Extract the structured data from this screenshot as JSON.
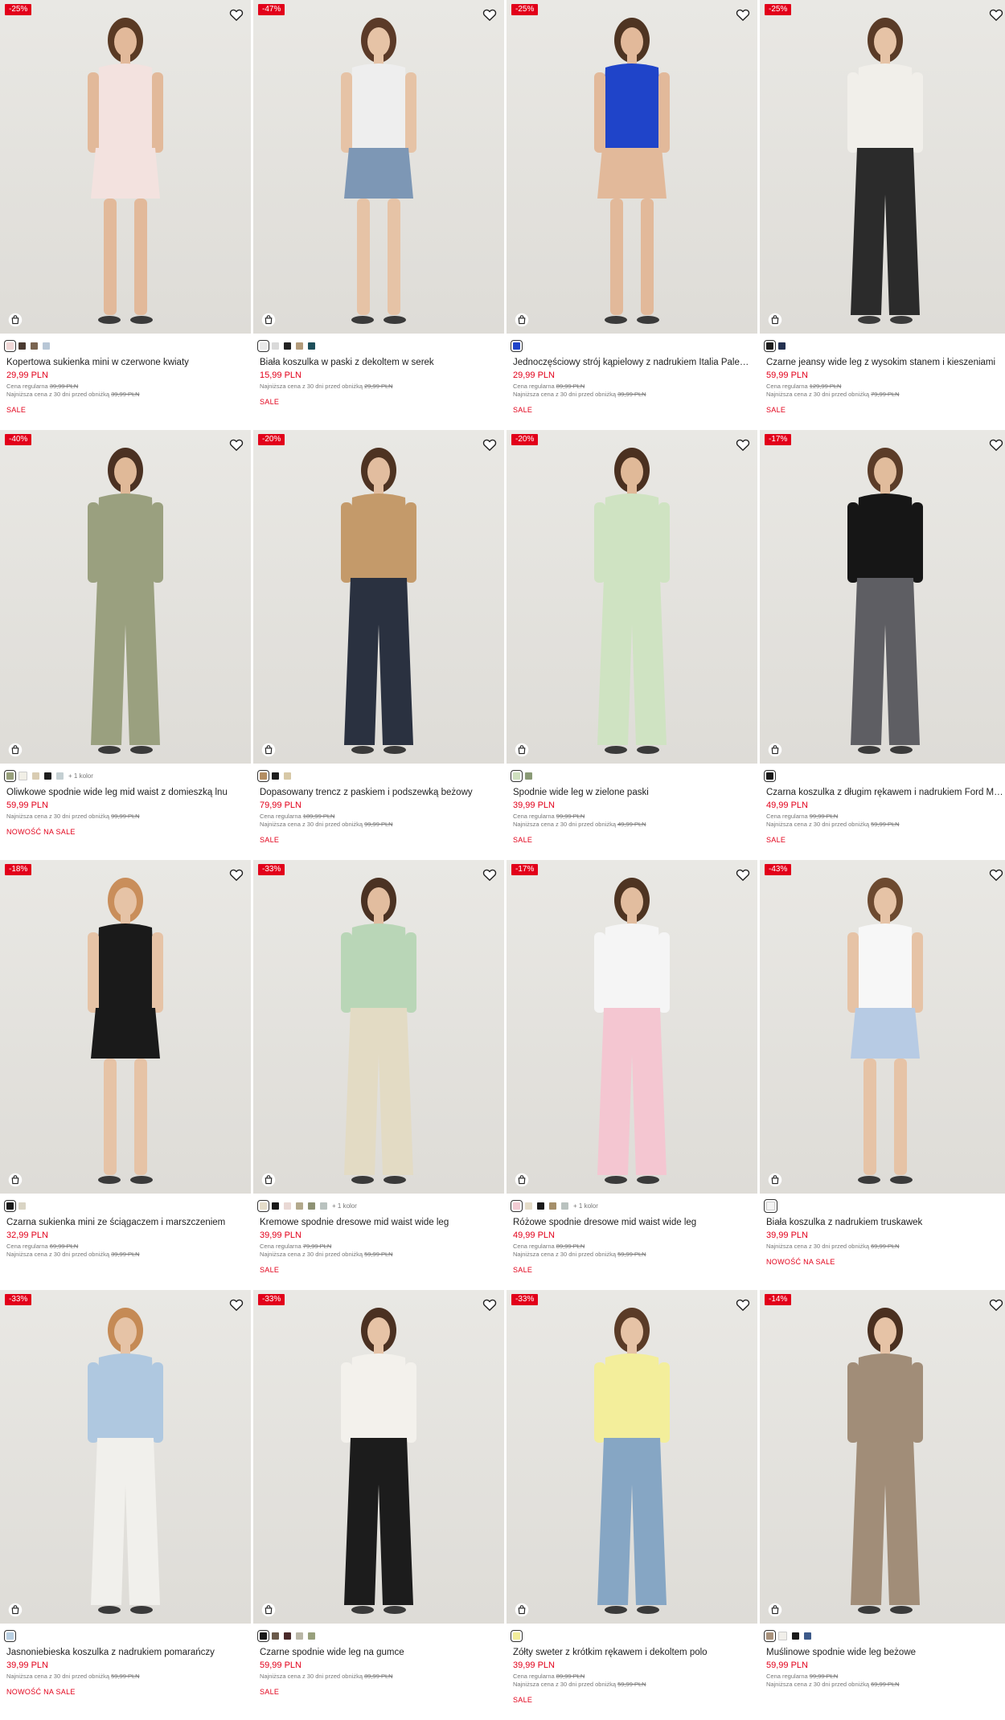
{
  "labels": {
    "regular": "Cena regularna",
    "lowest": "Najniższa cena z 30 dni przed obniżką"
  },
  "products": [
    {
      "discount": "-25%",
      "name": "Kopertowa sukienka mini w czerwone kwiaty",
      "price": "29,99 PLN",
      "regular": "39,99 PLN",
      "lowest": "39,99 PLN",
      "tag": "SALE",
      "swatches": [
        "#f0d7d6",
        "#4a3a30",
        "#7a6450",
        "#b8c7d6"
      ],
      "more": "",
      "top": "#f3e2df",
      "bottom": "#f3e2df",
      "skin": "#e2b99a",
      "hair": "#5a3a24",
      "long": false
    },
    {
      "discount": "-47%",
      "name": "Biała koszulka w paski z dekoltem w serek",
      "price": "15,99 PLN",
      "regular": "",
      "lowest": "29,99 PLN",
      "tag": "SALE",
      "swatches": [
        "#e9e9e9",
        "#d9d9d9",
        "#222222",
        "#b39b7a",
        "#1e4f5a"
      ],
      "more": "",
      "top": "#eeeeee",
      "bottom": "#7d97b5",
      "skin": "#e6c3a6",
      "hair": "#5b3a28",
      "long": false
    },
    {
      "discount": "-25%",
      "name": "Jednoczęściowy strój kąpielowy z nadrukiem Italia Palermo",
      "price": "29,99 PLN",
      "regular": "89,99 PLN",
      "lowest": "39,99 PLN",
      "tag": "SALE",
      "swatches": [
        "#1f44c9"
      ],
      "more": "",
      "top": "#1f44c9",
      "bottom": "#e2b99a",
      "skin": "#e2b99a",
      "hair": "#4e3422",
      "long": false
    },
    {
      "discount": "-25%",
      "name": "Czarne jeansy wide leg z wysokim stanem i kieszeniami",
      "price": "59,99 PLN",
      "regular": "129,99 PLN",
      "lowest": "79,99 PLN",
      "tag": "SALE",
      "swatches": [
        "#1e1e1e",
        "#243150"
      ],
      "more": "",
      "top": "#f1efea",
      "bottom": "#2b2b2b",
      "skin": "#e6c3a6",
      "hair": "#5a3b27",
      "long": true
    },
    {
      "discount": "-40%",
      "name": "Oliwkowe spodnie wide leg mid waist z domieszką lnu",
      "price": "59,99 PLN",
      "regular": "",
      "lowest": "99,99 PLN",
      "tag": "NOWOŚĆ NA SALE",
      "swatches": [
        "#98a07c",
        "#f1efe6",
        "#d9ccb2",
        "#1e1e1e",
        "#c4cfd2"
      ],
      "more": "+ 1 kolor",
      "top": "#9aa07f",
      "bottom": "#9aa07f",
      "skin": "#e0b998",
      "hair": "#4b3122",
      "long": true
    },
    {
      "discount": "-20%",
      "name": "Dopasowany trencz z paskiem i podszewką beżowy",
      "price": "79,99 PLN",
      "regular": "189,99 PLN",
      "lowest": "99,99 PLN",
      "tag": "SALE",
      "swatches": [
        "#b48e62",
        "#1e1e1e",
        "#d7c8a6"
      ],
      "more": "",
      "top": "#c49a6a",
      "bottom": "#2a3140",
      "skin": "#e2bd9f",
      "hair": "#4e3322",
      "long": true
    },
    {
      "discount": "-20%",
      "name": "Spodnie wide leg w zielone paski",
      "price": "39,99 PLN",
      "regular": "99,99 PLN",
      "lowest": "49,99 PLN",
      "tag": "SALE",
      "swatches": [
        "#cfe0bf",
        "#8a9a76"
      ],
      "more": "",
      "top": "#cfe3c2",
      "bottom": "#cfe3c2",
      "skin": "#e0b998",
      "hair": "#4a3020",
      "long": true
    },
    {
      "discount": "-17%",
      "name": "Czarna koszulka z długim rękawem i nadrukiem Ford Mustang",
      "price": "49,99 PLN",
      "regular": "99,99 PLN",
      "lowest": "59,99 PLN",
      "tag": "SALE",
      "swatches": [
        "#1a1a1a"
      ],
      "more": "",
      "top": "#161616",
      "bottom": "#5e5e63",
      "skin": "#e1bc9c",
      "hair": "#5b3c28",
      "long": true
    },
    {
      "discount": "-18%",
      "name": "Czarna sukienka mini ze ściągaczem i marszczeniem",
      "price": "32,99 PLN",
      "regular": "69,99 PLN",
      "lowest": "39,99 PLN",
      "tag": "",
      "swatches": [
        "#1a1a1a",
        "#d9d4c4"
      ],
      "more": "",
      "top": "#1a1a1a",
      "bottom": "#1a1a1a",
      "skin": "#e6c3a6",
      "hair": "#c98e5b",
      "long": false
    },
    {
      "discount": "-33%",
      "name": "Kremowe spodnie dresowe mid waist wide leg",
      "price": "39,99 PLN",
      "regular": "79,99 PLN",
      "lowest": "59,99 PLN",
      "tag": "SALE",
      "swatches": [
        "#e4dcc8",
        "#1a1a1a",
        "#e9d8d4",
        "#b3a98c",
        "#8e9274",
        "#b9c2bf"
      ],
      "more": "+ 1 kolor",
      "top": "#b9d6b7",
      "bottom": "#e3dbc4",
      "skin": "#e2bd9f",
      "hair": "#4b3223",
      "long": true
    },
    {
      "discount": "-17%",
      "name": "Różowe spodnie dresowe mid waist wide leg",
      "price": "49,99 PLN",
      "regular": "89,99 PLN",
      "lowest": "59,99 PLN",
      "tag": "SALE",
      "swatches": [
        "#f2cbd3",
        "#e4dcc8",
        "#1a1a1a",
        "#a58f6a",
        "#b9c2bf"
      ],
      "more": "+ 1 kolor",
      "top": "#f5f5f5",
      "bottom": "#f4c6d1",
      "skin": "#e2bd9f",
      "hair": "#4e3422",
      "long": true
    },
    {
      "discount": "-43%",
      "name": "Biała koszulka z nadrukiem truskawek",
      "price": "39,99 PLN",
      "regular": "",
      "lowest": "69,99 PLN",
      "tag": "NOWOŚĆ NA SALE",
      "swatches": [
        "#f4f4f4"
      ],
      "more": "",
      "top": "#f7f7f7",
      "bottom": "#b7cbe4",
      "skin": "#e6c3a6",
      "hair": "#6d4a30",
      "long": false
    },
    {
      "discount": "-33%",
      "name": "Jasnoniebieska koszulka z nadrukiem pomarańczy",
      "price": "39,99 PLN",
      "regular": "",
      "lowest": "59,99 PLN",
      "tag": "NOWOŚĆ NA SALE",
      "swatches": [
        "#b9cfe2"
      ],
      "more": "",
      "top": "#afc8e0",
      "bottom": "#f1f0ec",
      "skin": "#e6c3a6",
      "hair": "#c58a55",
      "long": true
    },
    {
      "discount": "-33%",
      "name": "Czarne spodnie wide leg na gumce",
      "price": "59,99 PLN",
      "regular": "",
      "lowest": "89,99 PLN",
      "tag": "SALE",
      "swatches": [
        "#1a1a1a",
        "#6a5a4a",
        "#4a2a2a",
        "#b9b6a6",
        "#98a07c"
      ],
      "more": "",
      "top": "#f3f1ec",
      "bottom": "#1c1c1c",
      "skin": "#e6c3a6",
      "hair": "#4b3122",
      "long": true
    },
    {
      "discount": "-33%",
      "name": "Żółty sweter z krótkim rękawem i dekoltem polo",
      "price": "39,99 PLN",
      "regular": "89,99 PLN",
      "lowest": "59,99 PLN",
      "tag": "SALE",
      "swatches": [
        "#f2ed9a"
      ],
      "more": "",
      "top": "#f3ee9b",
      "bottom": "#86a6c4",
      "skin": "#e6c3a6",
      "hair": "#5a3b27",
      "long": true
    },
    {
      "discount": "-14%",
      "name": "Muślinowe spodnie wide leg beżowe",
      "price": "59,99 PLN",
      "regular": "99,99 PLN",
      "lowest": "69,99 PLN",
      "tag": "",
      "swatches": [
        "#a8927c",
        "#f1efea",
        "#1a1a1a",
        "#3d5a8a"
      ],
      "more": "",
      "top": "#a18d78",
      "bottom": "#a18d78",
      "skin": "#e6c3a6",
      "hair": "#4a3020",
      "long": true
    }
  ]
}
